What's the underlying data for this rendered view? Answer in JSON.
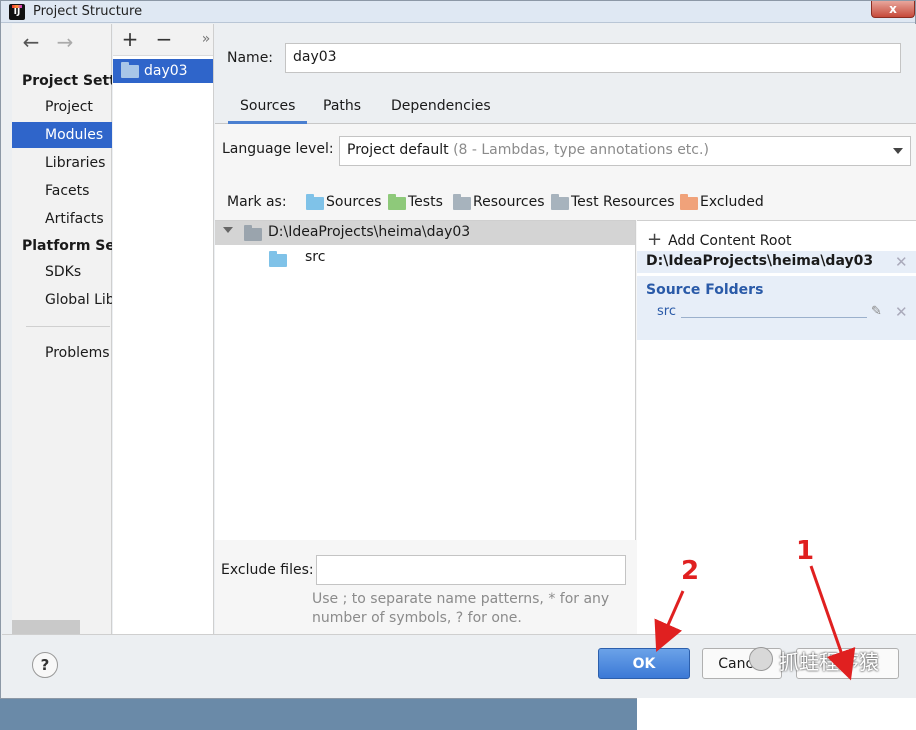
{
  "window": {
    "title": "Project Structure",
    "close": "x"
  },
  "nav": {
    "back_glyph": "←",
    "forward_glyph": "→",
    "project_settings_header": "Project Settings",
    "project_settings": [
      "Project",
      "Modules",
      "Libraries",
      "Facets",
      "Artifacts"
    ],
    "platform_settings_header": "Platform Settings",
    "platform_settings": [
      "SDKs",
      "Global Libraries"
    ],
    "problems": "Problems",
    "selected": "Modules"
  },
  "modules": {
    "add_glyph": "+",
    "remove_glyph": "−",
    "more_glyph": "»",
    "items": [
      "day03"
    ]
  },
  "module": {
    "name_label": "Name:",
    "name_value": "day03",
    "tabs": [
      "Sources",
      "Paths",
      "Dependencies"
    ],
    "active_tab": "Sources"
  },
  "sources": {
    "language_label": "Language level:",
    "language_value": "Project default",
    "language_detail": "(8 - Lambdas, type annotations etc.)",
    "mark_as_label": "Mark as:",
    "mark_as": [
      {
        "label": "Sources",
        "color": "#7fc2e8"
      },
      {
        "label": "Tests",
        "color": "#8ec97a"
      },
      {
        "label": "Resources",
        "color": "#a7b3bd"
      },
      {
        "label": "Test Resources",
        "color": "#a7b3bd"
      },
      {
        "label": "Excluded",
        "color": "#f0a27a"
      }
    ],
    "tree_root": "D:\\IdeaProjects\\heima\\day03",
    "tree_child": "src",
    "exclude_label": "Exclude files:",
    "exclude_value": "",
    "hint_line1": "Use ; to separate name patterns, * for any",
    "hint_line2": "number of symbols, ? for one."
  },
  "content_roots": {
    "add_label": "Add Content Root",
    "root_path": "D:\\IdeaProjects\\heima\\day03",
    "source_folders_label": "Source Folders",
    "source_entry": "src"
  },
  "buttons": {
    "help": "?",
    "ok": "OK",
    "cancel": "Cancel"
  },
  "annotations": {
    "one": "1",
    "two": "2",
    "color": "#e02020"
  },
  "watermark": "抓蛙程序猿"
}
